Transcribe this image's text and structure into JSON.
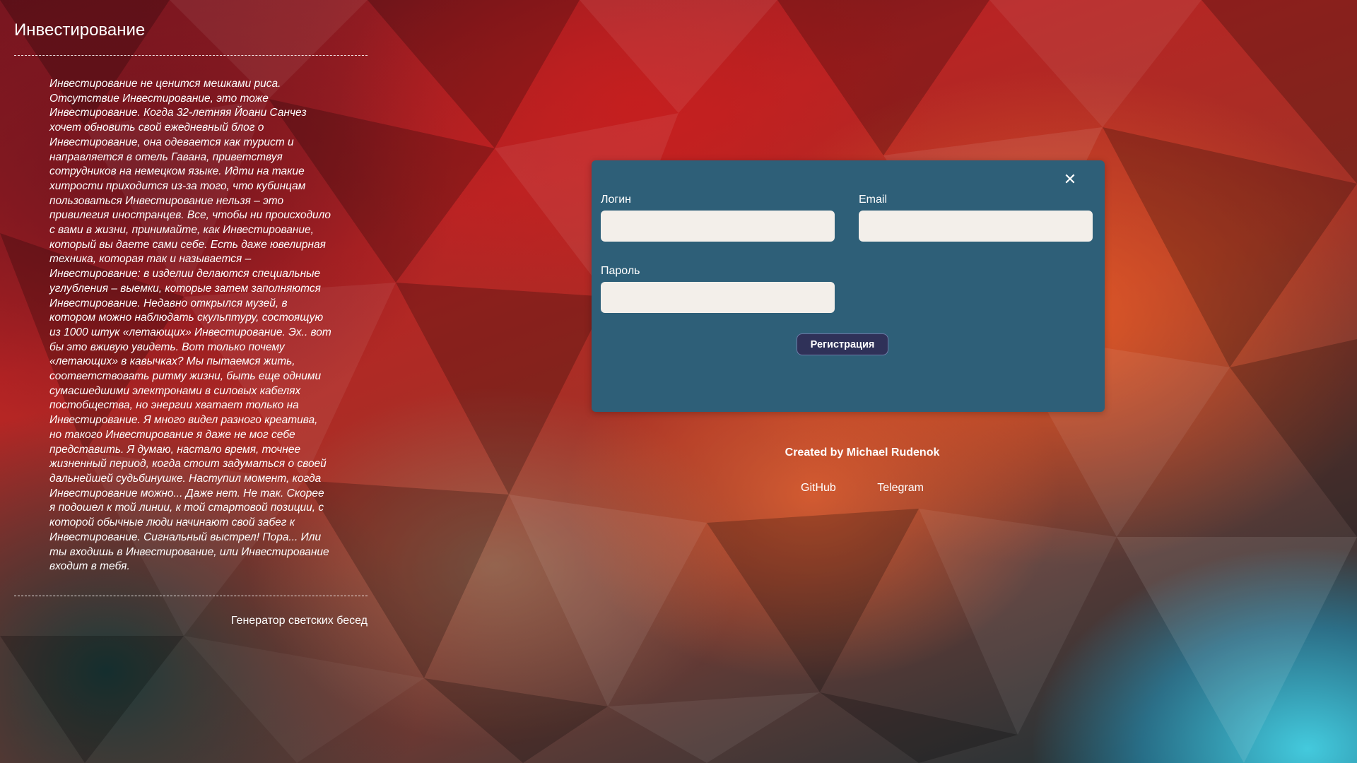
{
  "sidebar": {
    "title": "Инвестирование",
    "article": "Инвестирование не ценится мешками риса. Отсутствие Инвестирование, это тоже Инвестирование. Когда 32-летняя Йоани Санчез хочет обновить свой ежедневный блог о Инвестирование, она одевается как турист и направляется в отель Гавана, приветствуя сотрудников на немецком языке. Идти на такие хитрости приходится из-за того, что кубинцам пользоваться Инвестирование нельзя – это привилегия иностранцев. Все, чтобы ни происходило с вами в жизни, принимайте, как Инвестирование, который вы даете сами себе. Есть даже ювелирная техника, которая так и называется – Инвестирование: в изделии делаются специальные углубления – выемки, которые затем заполняются Инвестирование. Недавно открылся музей, в котором можно наблюдать скульптуру, состоящую из 1000 штук «летающих» Инвестирование. Эх.. вот бы это вживую увидеть. Вот только почему «летающих» в кавычках? Мы пытаемся жить, соответствовать ритму жизни, быть еще одними сумасшедшими электронами в силовых кабелях постобщества, но энергии хватает только на Инвестирование. Я много видел разного креатива, но такого Инвестирование я даже не мог себе представить. Я думаю, настало время, точнее жизненный период, когда стоит задуматься о своей дальнейшей судьбинушке. Наступил момент, когда Инвестирование можно... Даже нет. Не так. Скорее я подошел к той линии, к той стартовой позиции, с которой обычные люди начинают свой забег к Инвестирование. Сигнальный выстрел! Пора... Или ты входишь в Инвестирование, или Инвестирование входит в тебя.",
    "generator_link": "Генератор светских бесед"
  },
  "modal": {
    "close_icon": "close-icon",
    "close_glyph": "✕",
    "login_label": "Логин",
    "login_value": "",
    "email_label": "Email",
    "email_value": "",
    "password_label": "Пароль",
    "password_value": "",
    "register_button": "Регистрация",
    "background_color": "#2e5f78",
    "button_color": "#2f3158"
  },
  "footer": {
    "credits": "Created by Michael Rudenok",
    "github_link": "GitHub",
    "telegram_link": "Telegram"
  }
}
